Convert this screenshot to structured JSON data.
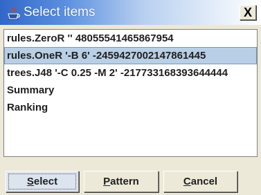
{
  "window": {
    "title": "Select items",
    "icon": "java-coffee-cup-icon",
    "close_label": "X"
  },
  "list": {
    "items": [
      {
        "label": "rules.ZeroR '' 48055541465867954",
        "selected": false
      },
      {
        "label": "rules.OneR '-B 6' -2459427002147861445",
        "selected": true
      },
      {
        "label": "trees.J48 '-C 0.25 -M 2' -217733168393644444",
        "selected": false
      },
      {
        "label": "Summary",
        "selected": false
      },
      {
        "label": "Ranking",
        "selected": false
      }
    ]
  },
  "buttons": {
    "select": {
      "mnemonic": "S",
      "rest": "elect"
    },
    "pattern": {
      "mnemonic": "P",
      "rest": "attern"
    },
    "cancel": {
      "mnemonic": "C",
      "rest": "ancel"
    }
  },
  "colors": {
    "title_bar_start": "#3168c8",
    "selection": "#b8cfe5"
  }
}
